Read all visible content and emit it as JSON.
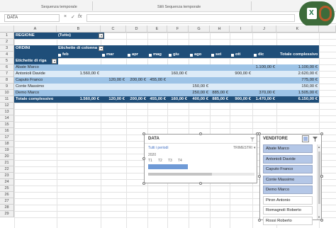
{
  "ribbon": {
    "group1": "Sequenza temporale",
    "group2": "Stili Sequenza temporale"
  },
  "formula_bar": {
    "name_box": "DATA",
    "cancel": "×",
    "enter": "✓",
    "fx": "fx",
    "content": ""
  },
  "columns": [
    "A",
    "B",
    "C",
    "D",
    "E",
    "F",
    "G",
    "H",
    "I",
    "J",
    "K"
  ],
  "rows": [
    "1",
    "2",
    "3",
    "4",
    "5",
    "6",
    "7",
    "8",
    "9",
    "10",
    "11",
    "12",
    "13",
    "14",
    "15",
    "16",
    "17",
    "18",
    "19",
    "20",
    "21",
    "22",
    "23",
    "24",
    "25",
    "26",
    "27",
    "28",
    "29"
  ],
  "pivot": {
    "filter_label": "REGIONE",
    "filter_value": "(Tutto)",
    "row_field": "ORDINI",
    "col_field": "Etichette di colonna",
    "row_labels": "Etichette di riga",
    "months": [
      "feb",
      "mar",
      "apr",
      "mag",
      "giu",
      "ago",
      "set",
      "ott",
      "dic"
    ],
    "total_header": "Totale complessivo",
    "rows": [
      {
        "name": "Abate Marco",
        "values": [
          "",
          "",
          "",
          "",
          "",
          "",
          "",
          "",
          "1.100,00 €"
        ],
        "total": "1.100,00 €"
      },
      {
        "name": "Antonioli Davide",
        "values": [
          "1.560,00 €",
          "",
          "",
          "",
          "160,00 €",
          "",
          "",
          "900,00 €",
          ""
        ],
        "total": "2.620,00 €"
      },
      {
        "name": "Caputo Franco",
        "values": [
          "",
          "120,00 €",
          "200,00 €",
          "455,00 €",
          "",
          "",
          "",
          "",
          ""
        ],
        "total": "775,00 €"
      },
      {
        "name": "Conte Massimo",
        "values": [
          "",
          "",
          "",
          "",
          "",
          "150,00 €",
          "",
          "",
          ""
        ],
        "total": "150,00 €"
      },
      {
        "name": "Demo Marco",
        "values": [
          "",
          "",
          "",
          "",
          "",
          "250,00 €",
          "885,00 €",
          "",
          "370,00 €"
        ],
        "total": "1.505,00 €"
      }
    ],
    "grand_total": {
      "name": "Totale complessivo",
      "values": [
        "1.560,00 €",
        "120,00 €",
        "200,00 €",
        "455,00 €",
        "160,00 €",
        "400,00 €",
        "885,00 €",
        "900,00 €",
        "1.470,00 €"
      ],
      "total": "6.150,00 €"
    }
  },
  "timeline": {
    "title": "DATA",
    "period_label": "Tutti i periodi",
    "level": "TRIMESTRI",
    "year": "2020",
    "quarters": [
      "T1",
      "T2",
      "T3",
      "T4"
    ],
    "selected_fraction": 1.0
  },
  "slicer": {
    "title": "VENDITORE",
    "items": [
      {
        "label": "Abate Marco",
        "selected": true
      },
      {
        "label": "Antonioli Davide",
        "selected": true
      },
      {
        "label": "Caputo Franco",
        "selected": true
      },
      {
        "label": "Conte Massimo",
        "selected": true
      },
      {
        "label": "Demo Marco",
        "selected": true
      },
      {
        "label": "Piron Antonio",
        "selected": false
      },
      {
        "label": "Romagnoli Roberto",
        "selected": false
      },
      {
        "label": "Rossi Roberto",
        "selected": false
      }
    ]
  },
  "colors": {
    "header_dark": "#1f4e79",
    "row_mid": "#9dc3e6",
    "row_light": "#ddebf7",
    "selected_item": "#b4c7e7",
    "timeline_bar": "#6f9ad6"
  }
}
